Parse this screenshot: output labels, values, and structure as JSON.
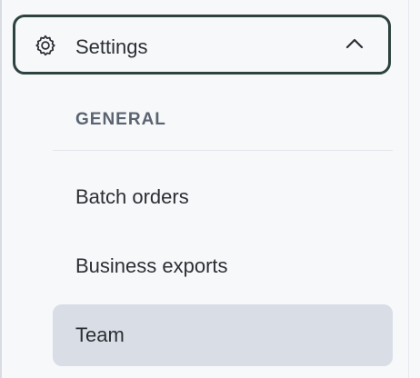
{
  "settings": {
    "label": "Settings",
    "expanded": true,
    "icon": "gear-icon",
    "chevron_icon": "chevron-up-icon"
  },
  "section": {
    "heading": "GENERAL"
  },
  "nav": {
    "items": [
      {
        "label": "Batch orders",
        "active": false
      },
      {
        "label": "Business exports",
        "active": false
      },
      {
        "label": "Team",
        "active": true
      }
    ]
  },
  "colors": {
    "header_border": "#2e4340",
    "active_bg": "#d8dde6",
    "heading_text": "#5a6470",
    "text": "#2b2f33",
    "background": "#f7f8fa"
  }
}
